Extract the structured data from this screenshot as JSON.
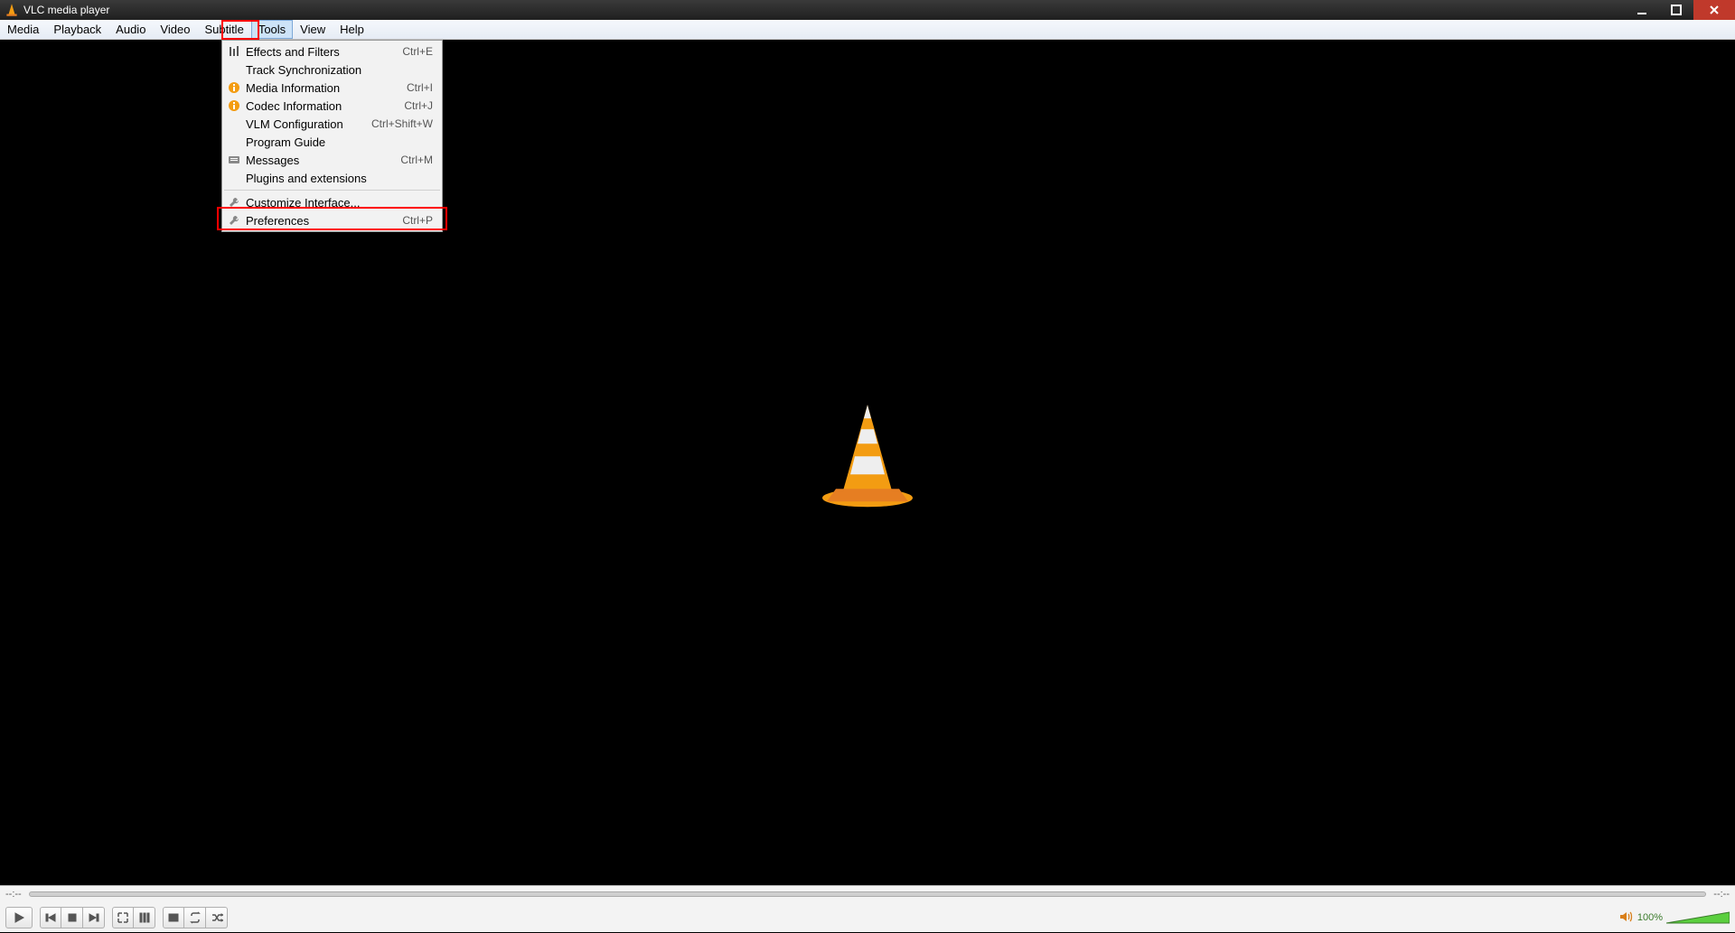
{
  "window": {
    "title": "VLC media player"
  },
  "menubar": {
    "items": [
      "Media",
      "Playback",
      "Audio",
      "Video",
      "Subtitle",
      "Tools",
      "View",
      "Help"
    ],
    "active_index": 5
  },
  "tools_menu": {
    "groups": [
      [
        {
          "icon": "equalizer-icon",
          "label": "Effects and Filters",
          "accel": "Ctrl+E"
        },
        {
          "icon": "",
          "label": "Track Synchronization",
          "accel": ""
        },
        {
          "icon": "info-icon",
          "label": "Media Information",
          "accel": "Ctrl+I"
        },
        {
          "icon": "info-icon",
          "label": "Codec Information",
          "accel": "Ctrl+J"
        },
        {
          "icon": "",
          "label": "VLM Configuration",
          "accel": "Ctrl+Shift+W"
        },
        {
          "icon": "",
          "label": "Program Guide",
          "accel": ""
        },
        {
          "icon": "messages-icon",
          "label": "Messages",
          "accel": "Ctrl+M"
        },
        {
          "icon": "",
          "label": "Plugins and extensions",
          "accel": ""
        }
      ],
      [
        {
          "icon": "wrench-icon",
          "label": "Customize Interface...",
          "accel": ""
        },
        {
          "icon": "wrench-icon",
          "label": "Preferences",
          "accel": "Ctrl+P"
        }
      ]
    ]
  },
  "time": {
    "elapsed": "--:--",
    "remaining": "--:--"
  },
  "volume": {
    "percent_label": "100%"
  }
}
